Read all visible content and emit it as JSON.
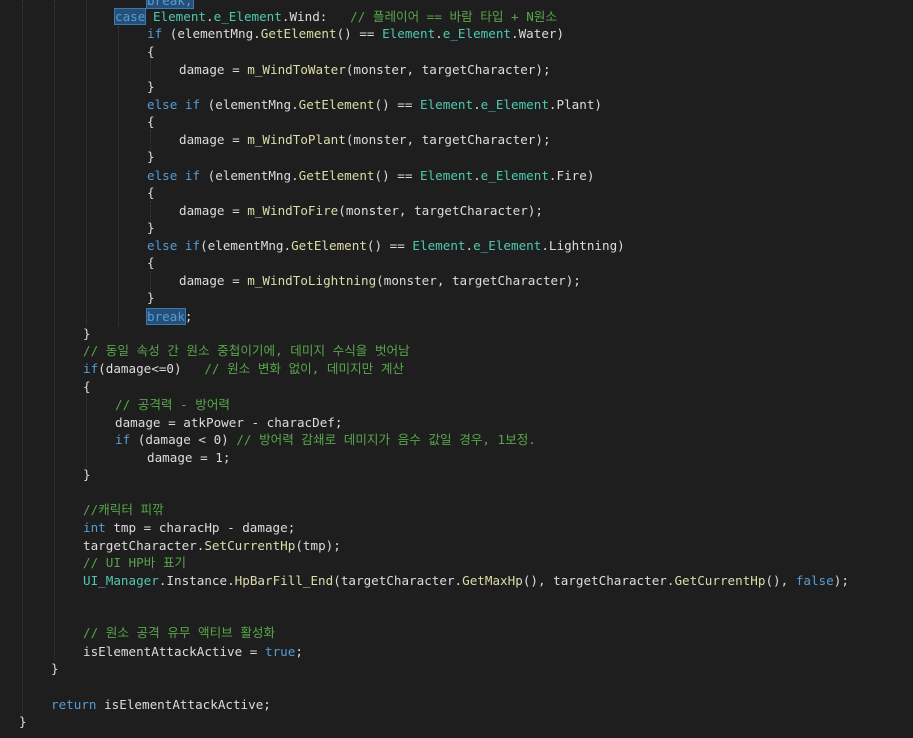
{
  "code": {
    "line_00": {
      "tokens": [
        {
          "t": "break;",
          "c": "kw hl"
        }
      ]
    },
    "line_01": {
      "tokens": [
        {
          "t": "case",
          "c": "kw hl"
        },
        {
          "t": " ",
          "c": "tx"
        },
        {
          "t": "Element",
          "c": "ty"
        },
        {
          "t": ".",
          "c": "tx"
        },
        {
          "t": "e_Element",
          "c": "ty"
        },
        {
          "t": ".Wind:   ",
          "c": "tx"
        },
        {
          "t": "// 플레이어 == 바람 타입 + N원소",
          "c": "cm"
        }
      ]
    },
    "line_02": {
      "tokens": [
        {
          "t": "if",
          "c": "kw"
        },
        {
          "t": " (elementMng.",
          "c": "tx"
        },
        {
          "t": "GetElement",
          "c": "fn"
        },
        {
          "t": "() == ",
          "c": "tx"
        },
        {
          "t": "Element",
          "c": "ty"
        },
        {
          "t": ".",
          "c": "tx"
        },
        {
          "t": "e_Element",
          "c": "ty"
        },
        {
          "t": ".Water)",
          "c": "tx"
        }
      ]
    },
    "line_03": {
      "tokens": [
        {
          "t": "{",
          "c": "tx"
        }
      ]
    },
    "line_04": {
      "tokens": [
        {
          "t": "damage = ",
          "c": "tx"
        },
        {
          "t": "m_WindToWater",
          "c": "fn"
        },
        {
          "t": "(monster, targetCharacter);",
          "c": "tx"
        }
      ]
    },
    "line_05": {
      "tokens": [
        {
          "t": "}",
          "c": "tx"
        }
      ]
    },
    "line_06": {
      "tokens": [
        {
          "t": "else if",
          "c": "kw"
        },
        {
          "t": " (elementMng.",
          "c": "tx"
        },
        {
          "t": "GetElement",
          "c": "fn"
        },
        {
          "t": "() == ",
          "c": "tx"
        },
        {
          "t": "Element",
          "c": "ty"
        },
        {
          "t": ".",
          "c": "tx"
        },
        {
          "t": "e_Element",
          "c": "ty"
        },
        {
          "t": ".Plant)",
          "c": "tx"
        }
      ]
    },
    "line_07": {
      "tokens": [
        {
          "t": "{",
          "c": "tx"
        }
      ]
    },
    "line_08": {
      "tokens": [
        {
          "t": "damage = ",
          "c": "tx"
        },
        {
          "t": "m_WindToPlant",
          "c": "fn"
        },
        {
          "t": "(monster, targetCharacter);",
          "c": "tx"
        }
      ]
    },
    "line_09": {
      "tokens": [
        {
          "t": "}",
          "c": "tx"
        }
      ]
    },
    "line_10": {
      "tokens": [
        {
          "t": "else if",
          "c": "kw"
        },
        {
          "t": " (elementMng.",
          "c": "tx"
        },
        {
          "t": "GetElement",
          "c": "fn"
        },
        {
          "t": "() == ",
          "c": "tx"
        },
        {
          "t": "Element",
          "c": "ty"
        },
        {
          "t": ".",
          "c": "tx"
        },
        {
          "t": "e_Element",
          "c": "ty"
        },
        {
          "t": ".Fire)",
          "c": "tx"
        }
      ]
    },
    "line_11": {
      "tokens": [
        {
          "t": "{",
          "c": "tx"
        }
      ]
    },
    "line_12": {
      "tokens": [
        {
          "t": "damage = ",
          "c": "tx"
        },
        {
          "t": "m_WindToFire",
          "c": "fn"
        },
        {
          "t": "(monster, targetCharacter);",
          "c": "tx"
        }
      ]
    },
    "line_13": {
      "tokens": [
        {
          "t": "}",
          "c": "tx"
        }
      ]
    },
    "line_14": {
      "tokens": [
        {
          "t": "else if",
          "c": "kw"
        },
        {
          "t": "(elementMng.",
          "c": "tx"
        },
        {
          "t": "GetElement",
          "c": "fn"
        },
        {
          "t": "() == ",
          "c": "tx"
        },
        {
          "t": "Element",
          "c": "ty"
        },
        {
          "t": ".",
          "c": "tx"
        },
        {
          "t": "e_Element",
          "c": "ty"
        },
        {
          "t": ".Lightning)",
          "c": "tx"
        }
      ]
    },
    "line_15": {
      "tokens": [
        {
          "t": "{",
          "c": "tx"
        }
      ]
    },
    "line_16": {
      "tokens": [
        {
          "t": "damage = ",
          "c": "tx"
        },
        {
          "t": "m_WindToLightning",
          "c": "fn"
        },
        {
          "t": "(monster, targetCharacter);",
          "c": "tx"
        }
      ]
    },
    "line_17": {
      "tokens": [
        {
          "t": "}",
          "c": "tx"
        }
      ]
    },
    "line_18": {
      "tokens": [
        {
          "t": "break",
          "c": "kw hl"
        },
        {
          "t": ";",
          "c": "tx"
        }
      ]
    },
    "line_19": {
      "tokens": [
        {
          "t": "}",
          "c": "tx"
        }
      ]
    },
    "line_20": {
      "tokens": [
        {
          "t": "// 동일 속성 간 원소 중첩이기에, 데미지 수식을 벗어남",
          "c": "cm"
        }
      ]
    },
    "line_21": {
      "tokens": [
        {
          "t": "if",
          "c": "kw"
        },
        {
          "t": "(damage<=0)   ",
          "c": "tx"
        },
        {
          "t": "// 원소 변화 없이, 데미지만 계산",
          "c": "cm"
        }
      ]
    },
    "line_22": {
      "tokens": [
        {
          "t": "{",
          "c": "tx"
        }
      ]
    },
    "line_23": {
      "tokens": [
        {
          "t": "// 공격력 - 방어력",
          "c": "cm"
        }
      ]
    },
    "line_24": {
      "tokens": [
        {
          "t": "damage = atkPower - characDef;",
          "c": "tx"
        }
      ]
    },
    "line_25": {
      "tokens": [
        {
          "t": "if",
          "c": "kw"
        },
        {
          "t": " (damage < 0) ",
          "c": "tx"
        },
        {
          "t": "// 방어력 감쇄로 데미지가 음수 값일 경우, 1보정.",
          "c": "cm"
        }
      ]
    },
    "line_26": {
      "tokens": [
        {
          "t": "damage = 1;",
          "c": "tx"
        }
      ]
    },
    "line_27": {
      "tokens": [
        {
          "t": "}",
          "c": "tx"
        }
      ]
    },
    "line_28": {
      "tokens": []
    },
    "line_29": {
      "tokens": [
        {
          "t": "//캐릭터 피깎",
          "c": "cm"
        }
      ]
    },
    "line_30": {
      "tokens": [
        {
          "t": "int",
          "c": "kw"
        },
        {
          "t": " tmp = characHp - damage;",
          "c": "tx"
        }
      ]
    },
    "line_31": {
      "tokens": [
        {
          "t": "targetCharacter.",
          "c": "tx"
        },
        {
          "t": "SetCurrentHp",
          "c": "fn"
        },
        {
          "t": "(tmp);",
          "c": "tx"
        }
      ]
    },
    "line_32": {
      "tokens": [
        {
          "t": "// UI HP바 표기",
          "c": "cm"
        }
      ]
    },
    "line_33": {
      "tokens": [
        {
          "t": "UI_Manager",
          "c": "ty"
        },
        {
          "t": ".Instance.",
          "c": "tx"
        },
        {
          "t": "HpBarFill_End",
          "c": "fn"
        },
        {
          "t": "(targetCharacter.",
          "c": "tx"
        },
        {
          "t": "GetMaxHp",
          "c": "fn"
        },
        {
          "t": "(), targetCharacter.",
          "c": "tx"
        },
        {
          "t": "GetCurrentHp",
          "c": "fn"
        },
        {
          "t": "(), ",
          "c": "tx"
        },
        {
          "t": "false",
          "c": "kw"
        },
        {
          "t": ");",
          "c": "tx"
        }
      ]
    },
    "line_34": {
      "tokens": []
    },
    "line_35": {
      "tokens": []
    },
    "line_36": {
      "tokens": [
        {
          "t": "// 원소 공격 유무 액티브 활성화",
          "c": "cm"
        }
      ]
    },
    "line_37": {
      "tokens": [
        {
          "t": "isElementAttackActive = ",
          "c": "tx"
        },
        {
          "t": "true",
          "c": "kw"
        },
        {
          "t": ";",
          "c": "tx"
        }
      ]
    },
    "line_38": {
      "tokens": [
        {
          "t": "}",
          "c": "tx"
        }
      ]
    },
    "line_39": {
      "tokens": []
    },
    "line_40": {
      "tokens": [
        {
          "t": "return",
          "c": "kw"
        },
        {
          "t": " isElementAttackActive;",
          "c": "tx"
        }
      ]
    },
    "line_41": {
      "tokens": [
        {
          "t": "}",
          "c": "tx"
        }
      ]
    }
  }
}
